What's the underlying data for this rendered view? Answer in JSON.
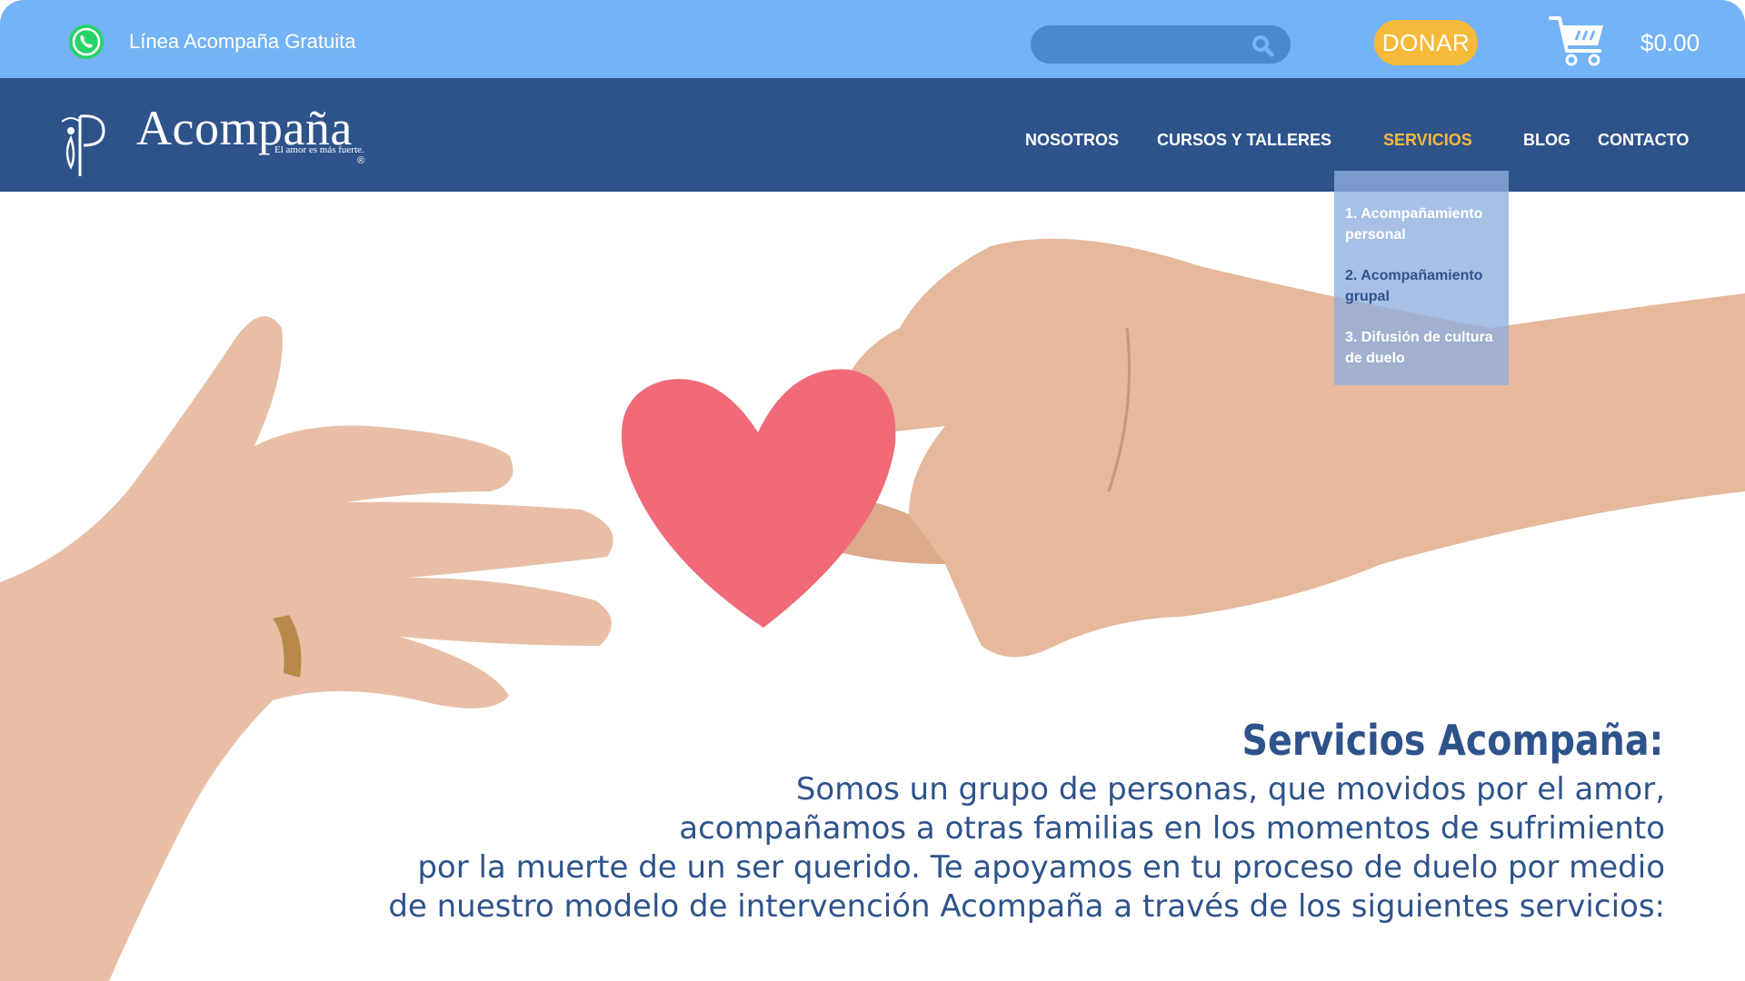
{
  "topbar": {
    "helpline": "Línea Acompaña Gratuita",
    "donate_label": "DONAR",
    "cart_total": "$0.00",
    "icons": {
      "whatsapp": "whatsapp-icon",
      "search": "search-icon",
      "cart": "shopping-cart-icon"
    },
    "colors": {
      "background": "#74b3f5",
      "donate": "#f6b93a",
      "search": "#4a88d0"
    }
  },
  "brand": {
    "name": "Acompaña",
    "tagline": "El amor es más fuerte.",
    "registered": "®"
  },
  "nav": {
    "items": [
      "NOSOTROS",
      "CURSOS Y TALLERES",
      "SERVICIOS",
      "BLOG",
      "CONTACTO"
    ],
    "active": "SERVICIOS",
    "colors": {
      "background": "#2e538b",
      "active": "#f6b93a"
    }
  },
  "dropdown": {
    "items": [
      "1. Acompañamiento personal",
      "2. Acompañamiento grupal",
      "3. Difusión de cultura de duelo"
    ],
    "current_index": 1
  },
  "hero": {
    "title": "Servicios Acompaña:",
    "lines": [
      "Somos un grupo de personas, que movidos por el amor,",
      "acompañamos a otras familias en los momentos de sufrimiento",
      "por la muerte de un ser querido. Te apoyamos en tu proceso de duelo por medio",
      "de nuestro modelo de intervención Acompaña a través de los siguientes servicios:"
    ],
    "image": "two hands passing a red paper heart",
    "text_color": "#2e538b"
  }
}
